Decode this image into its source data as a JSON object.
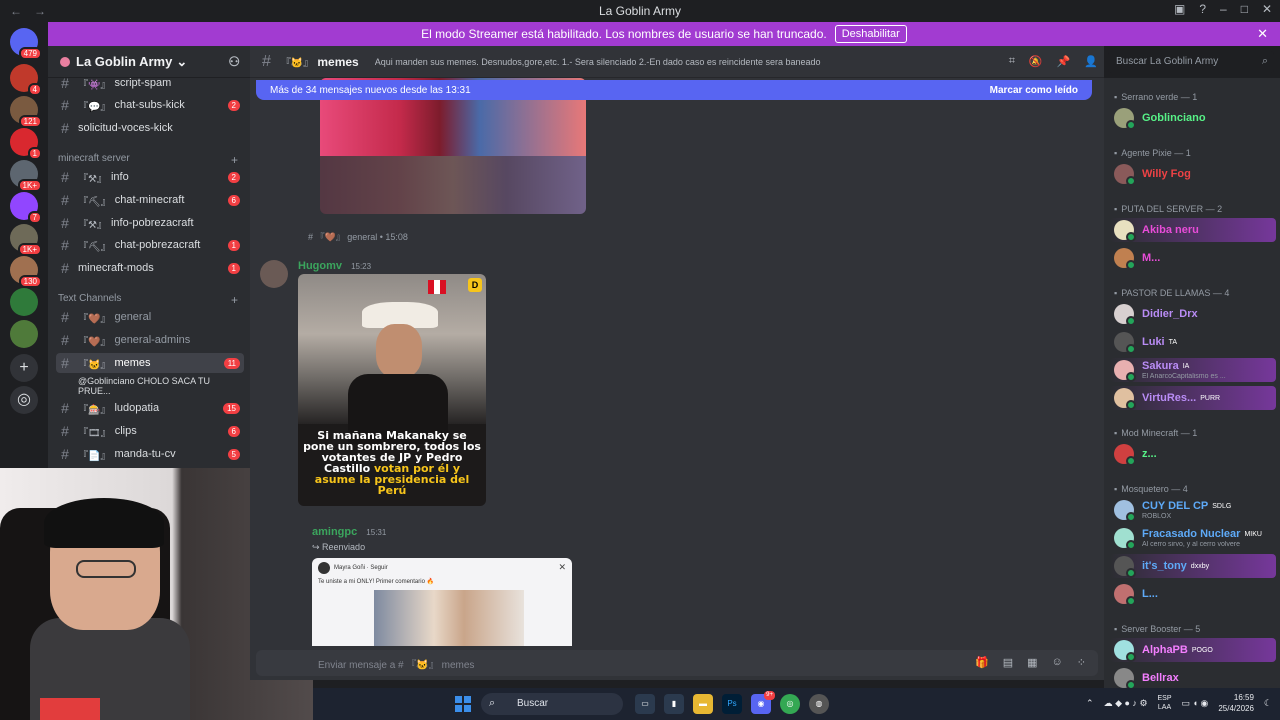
{
  "window": {
    "title": "La Goblin Army",
    "back": "←",
    "forward": "→"
  },
  "banner": {
    "text": "El modo Streamer está habilitado. Los nombres de usuario se han truncado.",
    "button": "Deshabilitar",
    "close": "✕"
  },
  "servers": [
    {
      "icon": "discord-home-icon",
      "badge": "479",
      "color": "#5865f2"
    },
    {
      "icon": "server-icon",
      "badge": "4",
      "color": "#c0392b"
    },
    {
      "icon": "server-icon",
      "badge": "121",
      "color": "#7a5a40"
    },
    {
      "icon": "server-icon",
      "badge": "1",
      "color": "#d9282f"
    },
    {
      "icon": "server-icon",
      "badge": "1K+",
      "color": "#5d6670"
    },
    {
      "icon": "server-icon",
      "badge": "7",
      "color": "#9146ff"
    },
    {
      "icon": "server-icon",
      "badge": "1K+",
      "color": "#6e6a58"
    },
    {
      "icon": "server-icon",
      "badge": "130",
      "color": "#a07050"
    },
    {
      "icon": "server-icon",
      "badge": "",
      "color": "#2f7a3a"
    },
    {
      "icon": "server-icon",
      "badge": "",
      "color": "#4f7a3a"
    },
    {
      "icon": "add-server-icon",
      "badge": "",
      "color": "#313338"
    },
    {
      "icon": "discover-icon",
      "badge": "",
      "color": "#313338"
    }
  ],
  "guild": {
    "name": "La Goblin Army",
    "chevron": "⌄"
  },
  "channels": {
    "top": [
      {
        "name": "script-spam",
        "emoji": "『👾』",
        "count": ""
      },
      {
        "name": "chat-subs-kick",
        "emoji": "『💬』",
        "count": "2"
      },
      {
        "name": "solicitud-voces-kick",
        "emoji": "",
        "count": ""
      }
    ],
    "category_minecraft": "minecraft server",
    "minecraft": [
      {
        "name": "info",
        "emoji": "『⚒』",
        "count": "2"
      },
      {
        "name": "chat-minecraft",
        "emoji": "『⛏』",
        "count": "6"
      },
      {
        "name": "info-pobrezacraft",
        "emoji": "『⚒』",
        "count": ""
      },
      {
        "name": "chat-pobrezacraft",
        "emoji": "『⛏』",
        "count": "1"
      },
      {
        "name": "minecraft-mods",
        "emoji": "",
        "count": "1"
      }
    ],
    "category_text": "Text Channels",
    "text": [
      {
        "name": "general",
        "emoji": "『🤎』",
        "count": ""
      },
      {
        "name": "general-admins",
        "emoji": "『🤎』",
        "count": ""
      },
      {
        "name": "memes",
        "emoji": "『🐱』",
        "count": "11"
      },
      {
        "name": "@Goblinciano CHOLO SACA TU PRUE...",
        "emoji": "",
        "count": ""
      },
      {
        "name": "ludopatia",
        "emoji": "『🎰』",
        "count": "15"
      },
      {
        "name": "clips",
        "emoji": "『🎞』",
        "count": "6"
      },
      {
        "name": "manda-tu-cv",
        "emoji": "『📄』",
        "count": "5"
      }
    ]
  },
  "header": {
    "channel": "memes",
    "emoji": "『🐱』",
    "topic": "Aqui manden sus memes. Desnudos,gore,etc. 1.- Sera silenciado 2.-En dado caso es reincidente sera baneado",
    "search_placeholder": "Buscar La Goblin Army"
  },
  "newbar": {
    "text": "Más de 34 mensajes nuevos desde las 13:31",
    "action": "Marcar como leído"
  },
  "messages": {
    "forward_from": "# 『🤎』 general • 15:08",
    "m1": {
      "author": "Hugomv",
      "time": "15:23",
      "caption_white1": "Si mañana Makanaky se pone un sombrero, todos los votantes de JP y Pedro Castillo ",
      "caption_yellow": "votan por él y asume la presidencia del Perú",
      "logo": "D"
    },
    "m2": {
      "author": "amingpc",
      "time": "15:31",
      "forwarded": "↪ Reenviado",
      "post_user": "Mayra Goñi · Seguir",
      "post_text": "Te uniste a mi ONLY! Primer comentario 🔥"
    }
  },
  "input": {
    "placeholder": "Enviar mensaje a # 『🐱』 memes"
  },
  "members": {
    "groups": [
      {
        "title": "Serrano verde — 1",
        "members": [
          {
            "name": "Goblinciano",
            "color": "#57f287",
            "tag": "",
            "sub": "",
            "boost": false,
            "av": "#9aa07a"
          }
        ]
      },
      {
        "title": "Agente Pixie — 1",
        "members": [
          {
            "name": "Willy Fog",
            "color": "#ed4245",
            "tag": "",
            "sub": "",
            "boost": false,
            "av": "#8a5a5a"
          }
        ]
      },
      {
        "title": "PUTA DEL SERVER — 2",
        "members": [
          {
            "name": "Akiba neru",
            "color": "#e84cd8",
            "tag": "",
            "sub": "",
            "boost": true,
            "av": "#e8e0c0"
          },
          {
            "name": "M...",
            "color": "#e84cd8",
            "tag": "",
            "sub": "",
            "boost": false,
            "av": "#c08050"
          }
        ]
      },
      {
        "title": "PASTOR DE LLAMAS — 4",
        "members": [
          {
            "name": "Didier_Drx",
            "color": "#b98cf5",
            "tag": "",
            "sub": "",
            "boost": false,
            "av": "#d8d0d0"
          },
          {
            "name": "Luki",
            "color": "#b98cf5",
            "tag": "TA",
            "sub": "",
            "boost": false,
            "av": "#555"
          },
          {
            "name": "Sakura",
            "color": "#b98cf5",
            "tag": "IA",
            "sub": "El AnarcoCapitalismo es ...",
            "boost": true,
            "av": "#e8b0b0"
          },
          {
            "name": "VirtuRes...",
            "color": "#b98cf5",
            "tag": "PURR",
            "sub": "",
            "boost": true,
            "av": "#e0c0a0"
          }
        ]
      },
      {
        "title": "Mod Minecraft — 1",
        "members": [
          {
            "name": "z...",
            "color": "#57f287",
            "tag": "",
            "sub": "",
            "boost": false,
            "av": "#d04040"
          }
        ]
      },
      {
        "title": "Mosquetero — 4",
        "members": [
          {
            "name": "CUY DEL CP",
            "color": "#5eaaf8",
            "tag": "SDLG",
            "sub": "ROBLOX",
            "boost": false,
            "av": "#a0c0e0"
          },
          {
            "name": "Fracasado Nuclear",
            "color": "#5eaaf8",
            "tag": "MIKU",
            "sub": "Al cerro sirvo, y al cerro volvere",
            "boost": false,
            "av": "#a0e0d0"
          },
          {
            "name": "it's_tony",
            "color": "#5eaaf8",
            "tag": "dxxby",
            "sub": "",
            "boost": true,
            "av": "#555"
          },
          {
            "name": "L...",
            "color": "#5eaaf8",
            "tag": "",
            "sub": "",
            "boost": false,
            "av": "#c07070"
          }
        ]
      },
      {
        "title": "Server Booster — 5",
        "members": [
          {
            "name": "AlphaPB",
            "color": "#f47fff",
            "tag": "POGO",
            "sub": "",
            "boost": true,
            "av": "#a0e0e0"
          },
          {
            "name": "Bellrax",
            "color": "#f47fff",
            "tag": "",
            "sub": "",
            "boost": false,
            "av": "#888"
          }
        ]
      }
    ]
  },
  "taskbar": {
    "search": "Buscar",
    "lang1": "ESP",
    "lang2": "LAA",
    "time": "16:59",
    "date": "25/4/2026"
  }
}
